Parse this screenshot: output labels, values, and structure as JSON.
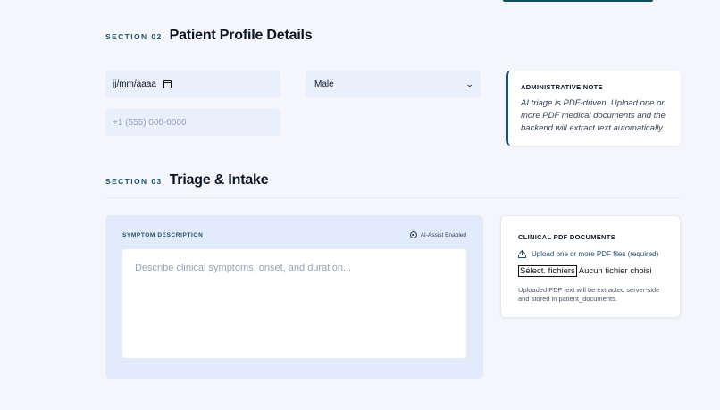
{
  "section2": {
    "tag": "SECTION 02",
    "title": "Patient Profile Details",
    "dob_placeholder": "jj/mm/aaaa",
    "sex_value": "Male",
    "phone_placeholder": "+1 (555) 000-0000"
  },
  "admin_note": {
    "title": "ADMINISTRATIVE NOTE",
    "body": "AI triage is PDF-driven. Upload one or more PDF medical documents and the backend will extract text automatically."
  },
  "section3": {
    "tag": "SECTION 03",
    "title": "Triage & Intake"
  },
  "symptom": {
    "label": "SYMPTOM DESCRIPTION",
    "ai_badge": "AI-Assist Enabled",
    "placeholder": "Describe clinical symptoms, onset, and duration..."
  },
  "pdf": {
    "title": "CLINICAL PDF DOCUMENTS",
    "upload_label": "Upload one or more PDF files (required)",
    "file_button": "Sélect. fichiers",
    "file_status": "Aucun fichier choisi",
    "help": "Uploaded PDF text will be extracted server-side and stored in patient_documents."
  },
  "colors": {
    "accent": "#1e4f6d",
    "panel_bg": "#e2ebfb",
    "field_bg": "#e9effb"
  },
  "icons": [
    "calendar-icon",
    "chevron-down-icon",
    "ai-assist-icon",
    "upload-icon"
  ]
}
